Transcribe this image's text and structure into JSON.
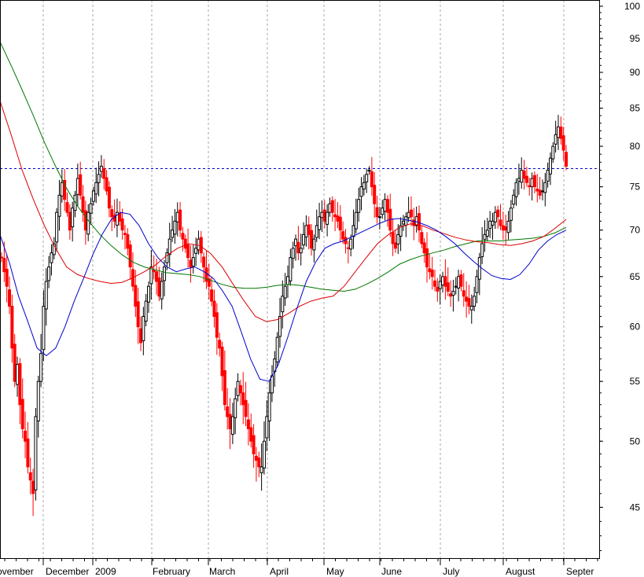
{
  "chart_data": {
    "type": "candlestick",
    "y_scale": "log",
    "ylim": [
      41.5,
      101
    ],
    "y_ticks": [
      100,
      95,
      90,
      85,
      80,
      75,
      70,
      65,
      60,
      55,
      50,
      45
    ],
    "x_labels": [
      "ovember",
      "December",
      "2009",
      "February",
      "March",
      "April",
      "May",
      "June",
      "July",
      "August",
      "Septer"
    ],
    "grid": "vertical dotted at month starts",
    "reference_line": {
      "value": 77.2,
      "style": "dashed",
      "color": "#0000cc"
    },
    "colors": {
      "up": "#000000",
      "down": "#ff0000",
      "ma_short": "#0000cc",
      "ma_mid": "#dd0000",
      "ma_long": "#007700"
    },
    "closes": [
      67,
      65.5,
      64,
      62,
      58,
      55,
      56.5,
      53,
      51,
      50,
      48,
      47,
      46,
      52,
      55,
      57.5,
      62,
      64.5,
      66,
      67.5,
      68.5,
      72,
      74,
      75.5,
      73.5,
      72,
      70,
      72.5,
      74,
      76,
      74,
      72,
      70,
      72,
      73,
      74.5,
      75.5,
      76.5,
      77.5,
      76,
      74.5,
      72.5,
      71.5,
      71,
      72,
      71,
      70,
      69.5,
      68,
      66,
      64,
      62,
      60,
      58.5,
      61,
      62.5,
      64,
      66,
      65.5,
      64.5,
      63,
      64.5,
      66,
      67.5,
      69,
      70,
      71,
      72,
      70,
      69,
      68,
      67,
      66,
      67,
      68,
      69,
      67.5,
      66,
      64.5,
      64,
      62.5,
      61,
      59,
      58,
      55.5,
      53,
      52,
      51,
      52,
      53.5,
      55,
      54,
      53,
      52,
      51,
      50,
      49,
      48.5,
      48,
      48,
      50,
      52,
      54,
      55.5,
      57,
      59,
      61,
      63,
      64,
      65,
      67,
      68,
      69,
      67.5,
      68,
      69.5,
      70.5,
      69.5,
      68,
      69,
      70.5,
      71.5,
      72,
      71,
      72,
      73,
      72,
      71.5,
      71,
      70,
      69,
      68.5,
      68,
      69,
      70.5,
      72,
      73.5,
      75,
      75.5,
      76.5,
      77,
      75,
      73,
      71.5,
      71.5,
      72.5,
      73.5,
      72,
      70,
      68.5,
      68,
      69.5,
      70.5,
      71,
      71.5,
      72,
      71.5,
      70.5,
      71.5,
      70,
      68.5,
      67.5,
      66,
      65.5,
      65,
      64,
      63.5,
      64.5,
      65,
      64,
      63.5,
      63,
      63.5,
      64,
      65,
      64,
      63,
      62.5,
      62,
      62,
      63,
      65,
      67,
      68.5,
      69.5,
      70,
      71,
      71,
      72,
      71.5,
      70.5,
      70,
      70,
      71,
      72.5,
      74,
      75.5,
      76,
      77,
      76,
      75.5,
      75,
      76,
      75,
      74.5,
      74,
      74.5,
      75.5,
      77,
      78.5,
      80,
      81.5,
      82.5,
      81,
      79.5,
      77.5
    ],
    "ma_short": [
      69.5,
      66.5,
      63,
      60.5,
      58,
      57.3,
      58,
      60,
      62.5,
      64.8,
      67.3,
      69.5,
      71.2,
      72,
      71.8,
      70.5,
      68.5,
      67,
      66,
      65.5,
      65.8,
      66,
      65.5,
      64.8,
      63.5,
      62,
      59.5,
      57,
      55.2,
      55,
      56.5,
      59,
      61.8,
      64.5,
      66.5,
      68,
      68.5,
      68.8,
      69.3,
      69.8,
      70.3,
      70.8,
      71.2,
      71.3,
      71.1,
      70.9,
      70.5,
      70,
      69.3,
      68.5,
      67.5,
      66.6,
      65.8,
      65.1,
      64.8,
      64.7,
      65.2,
      66.3,
      67.8,
      68.8,
      69.5,
      70
    ],
    "ma_mid": [
      86,
      81.5,
      77,
      73.5,
      70.5,
      68,
      66,
      65.2,
      64.8,
      64.5,
      64.3,
      64.4,
      64.9,
      65.5,
      66.2,
      67.2,
      68,
      68.5,
      68.3,
      67.4,
      66,
      64.2,
      62.5,
      61,
      60.5,
      60.7,
      61.3,
      62,
      62.5,
      62.8,
      63,
      64,
      65.5,
      67,
      68.5,
      69.5,
      70.3,
      70.7,
      70.5,
      70,
      69.6,
      69.2,
      68.9,
      68.7,
      68.6,
      68.4,
      68.3,
      68.5,
      68.8,
      69.3,
      70.2,
      71.2
    ],
    "ma_long": [
      94.5,
      91,
      87.5,
      84,
      80.5,
      77.5,
      74.8,
      72.7,
      71,
      69.5,
      68.3,
      67.3,
      66.5,
      66,
      65.7,
      65.4,
      65.3,
      65.2,
      65,
      64.6,
      64.2,
      63.9,
      63.8,
      63.8,
      63.9,
      64.1,
      64.2,
      64.1,
      63.9,
      63.7,
      63.6,
      63.5,
      63.7,
      64.2,
      64.8,
      65.5,
      66.3,
      66.8,
      67.2,
      67.5,
      67.8,
      68.2,
      68.5,
      68.8,
      68.8,
      68.8,
      68.9,
      69,
      69.1,
      69.3,
      69.7,
      70.3
    ]
  }
}
